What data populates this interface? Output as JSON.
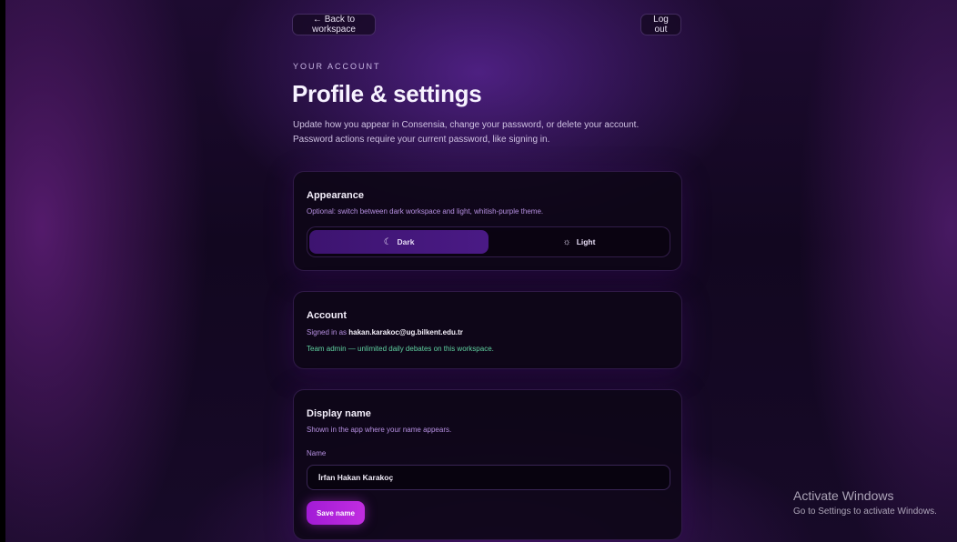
{
  "nav": {
    "back_label": "← Back to workspace",
    "logout_label": "Log out"
  },
  "header": {
    "eyebrow": "YOUR ACCOUNT",
    "title": "Profile & settings",
    "intro": "Update how you appear in Consensia, change your password, or delete your account. Password actions require your current password, like signing in."
  },
  "appearance": {
    "title": "Appearance",
    "subtitle": "Optional: switch between dark workspace and light, whitish-purple theme.",
    "options": [
      {
        "label": "Dark",
        "icon": "moon-icon",
        "glyph": "☾",
        "selected": true
      },
      {
        "label": "Light",
        "icon": "sun-icon",
        "glyph": "☼",
        "selected": false
      }
    ]
  },
  "account": {
    "title": "Account",
    "signed_in_prefix": "Signed in as ",
    "email": "hakan.karakoc@ug.bilkent.edu.tr",
    "role_note": "Team admin — unlimited daily debates on this workspace."
  },
  "display_name": {
    "title": "Display name",
    "subtitle": "Shown in the app where your name appears.",
    "field_label": "Name",
    "value": "İrfan Hakan Karakoç",
    "save_label": "Save name"
  },
  "windows_watermark": {
    "line1": "Activate Windows",
    "line2": "Go to Settings to activate Windows."
  },
  "colors": {
    "accent": "#b224dc",
    "selected_segment": "#451883",
    "role_note": "#5fd1a0"
  }
}
